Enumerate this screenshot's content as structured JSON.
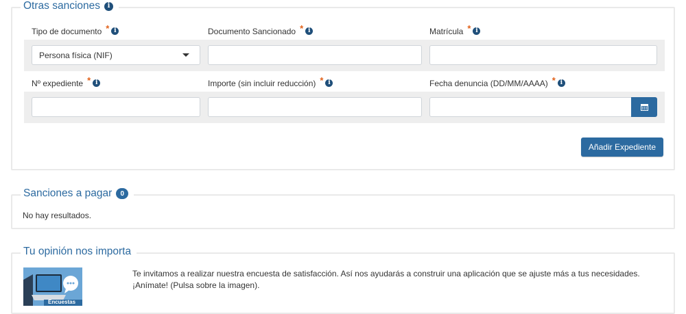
{
  "otras_sanciones": {
    "title": "Otras sanciones",
    "labels": {
      "tipo_documento": "Tipo de documento",
      "documento_sancionado": "Documento Sancionado",
      "matricula": "Matrícula",
      "num_expediente": "Nº expediente",
      "importe": "Importe (sin incluir reducción)",
      "fecha_denuncia": "Fecha denuncia (DD/MM/AAAA)"
    },
    "required_mark": "*",
    "tipo_documento_value": "Persona física (NIF)",
    "documento_sancionado_value": "",
    "matricula_value": "",
    "num_expediente_value": "",
    "importe_value": "",
    "fecha_denuncia_value": "",
    "add_button": "Añadir Expediente"
  },
  "sanciones_pagar": {
    "title": "Sanciones a pagar",
    "count": "0",
    "empty_text": "No hay resultados."
  },
  "opinion": {
    "title": "Tu opinión nos importa",
    "text_line1": "Te invitamos a realizar nuestra encuesta de satisfacción. Así nos ayudarás a construir una aplicación que se ajuste más a tus necesidades.",
    "text_line2": "¡Anímate! (Pulsa sobre la imagen).",
    "image_label": "Encuestas"
  },
  "icons": {
    "info": "info-icon",
    "calendar": "calendar-icon",
    "caret": "chevron-down-icon"
  },
  "colors": {
    "accent": "#2c6aa0",
    "required": "#e2621b"
  }
}
